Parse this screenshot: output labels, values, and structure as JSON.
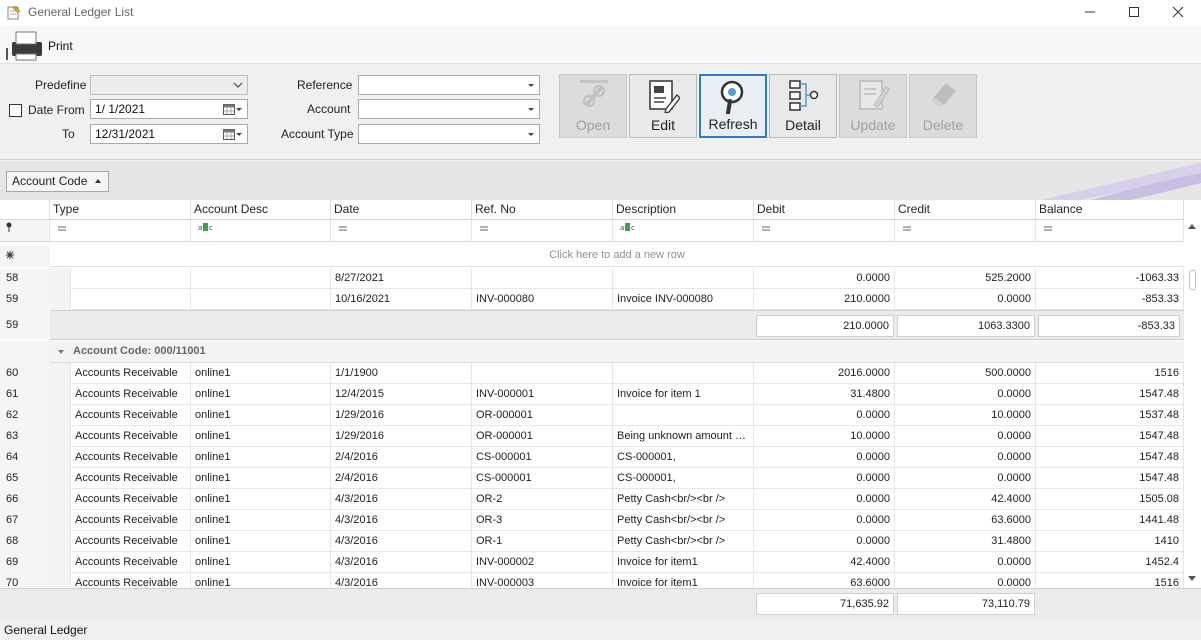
{
  "window": {
    "title": "General Ledger List",
    "minimize_icon": "minimize-icon",
    "maximize_icon": "maximize-icon",
    "close_icon": "close-icon"
  },
  "toolbar": {
    "print_label": "Print",
    "print_icon": "printer-icon"
  },
  "filters": {
    "predefine_label": "Predefine",
    "predefine_value": "",
    "date_from_label": "Date From",
    "date_from_checked": false,
    "date_from_value": "1/  1/2021",
    "to_label": "To",
    "to_value": "12/31/2021",
    "reference_label": "Reference",
    "reference_value": "",
    "account_label": "Account",
    "account_value": "",
    "account_type_label": "Account Type",
    "account_type_value": ""
  },
  "actions": {
    "open": {
      "label": "Open",
      "enabled": false,
      "icon": "link-icon"
    },
    "edit": {
      "label": "Edit",
      "enabled": true,
      "icon": "edit-document-icon"
    },
    "refresh": {
      "label": "Refresh",
      "enabled": true,
      "selected": true,
      "icon": "search-refresh-icon"
    },
    "detail": {
      "label": "Detail",
      "enabled": true,
      "icon": "hierarchy-icon"
    },
    "update": {
      "label": "Update",
      "enabled": false,
      "icon": "update-icon"
    },
    "delete": {
      "label": "Delete",
      "enabled": false,
      "icon": "eraser-icon"
    }
  },
  "group_panel": {
    "group_by": "Account Code",
    "sort": "ascending"
  },
  "grid": {
    "columns": [
      "Type",
      "Account Desc",
      "Date",
      "Ref. No",
      "Description",
      "Debit",
      "Credit",
      "Balance"
    ],
    "new_row_text": "Click here to add a new row",
    "top_rows": [
      {
        "n": "58",
        "type": "",
        "desc": "",
        "date": "8/27/2021",
        "ref": "",
        "description": "",
        "debit": "0.0000",
        "credit": "525.2000",
        "balance": "-1063.33"
      },
      {
        "n": "59",
        "type": "",
        "desc": "",
        "date": "10/16/2021",
        "ref": "INV-000080",
        "description": "Invoice INV-000080",
        "debit": "210.0000",
        "credit": "0.0000",
        "balance": "-853.33"
      }
    ],
    "subtotal": {
      "n": "59",
      "debit": "210.0000",
      "credit": "1063.3300",
      "balance": "-853.33"
    },
    "group_label": "Account Code: 000/11001",
    "rows": [
      {
        "n": "60",
        "type": "Accounts Receivable",
        "desc": "online1",
        "date": "1/1/1900",
        "ref": "",
        "description": "",
        "debit": "2016.0000",
        "credit": "500.0000",
        "balance": "1516"
      },
      {
        "n": "61",
        "type": "Accounts Receivable",
        "desc": "online1",
        "date": "12/4/2015",
        "ref": "INV-000001",
        "description": "Invoice for item 1",
        "debit": "31.4800",
        "credit": "0.0000",
        "balance": "1547.48"
      },
      {
        "n": "62",
        "type": "Accounts Receivable",
        "desc": "online1",
        "date": "1/29/2016",
        "ref": "OR-000001",
        "description": "",
        "debit": "0.0000",
        "credit": "10.0000",
        "balance": "1537.48"
      },
      {
        "n": "63",
        "type": "Accounts Receivable",
        "desc": "online1",
        "date": "1/29/2016",
        "ref": "OR-000001",
        "description": "Being unknown amount u...",
        "debit": "10.0000",
        "credit": "0.0000",
        "balance": "1547.48"
      },
      {
        "n": "64",
        "type": "Accounts Receivable",
        "desc": "online1",
        "date": "2/4/2016",
        "ref": "CS-000001",
        "description": "CS-000001,",
        "debit": "0.0000",
        "credit": "0.0000",
        "balance": "1547.48"
      },
      {
        "n": "65",
        "type": "Accounts Receivable",
        "desc": "online1",
        "date": "2/4/2016",
        "ref": "CS-000001",
        "description": "CS-000001,",
        "debit": "0.0000",
        "credit": "0.0000",
        "balance": "1547.48"
      },
      {
        "n": "66",
        "type": "Accounts Receivable",
        "desc": "online1",
        "date": "4/3/2016",
        "ref": "OR-2",
        "description": "Petty Cash<br/><br />",
        "debit": "0.0000",
        "credit": "42.4000",
        "balance": "1505.08"
      },
      {
        "n": "67",
        "type": "Accounts Receivable",
        "desc": "online1",
        "date": "4/3/2016",
        "ref": "OR-3",
        "description": "Petty Cash<br/><br />",
        "debit": "0.0000",
        "credit": "63.6000",
        "balance": "1441.48"
      },
      {
        "n": "68",
        "type": "Accounts Receivable",
        "desc": "online1",
        "date": "4/3/2016",
        "ref": "OR-1",
        "description": "Petty Cash<br/><br />",
        "debit": "0.0000",
        "credit": "31.4800",
        "balance": "1410"
      },
      {
        "n": "69",
        "type": "Accounts Receivable",
        "desc": "online1",
        "date": "4/3/2016",
        "ref": "INV-000002",
        "description": "Invoice for item1",
        "debit": "42.4000",
        "credit": "0.0000",
        "balance": "1452.4"
      },
      {
        "n": "70",
        "type": "Accounts Receivable",
        "desc": "online1",
        "date": "4/3/2016",
        "ref": "INV-000003",
        "description": "Invoice for item1",
        "debit": "63.6000",
        "credit": "0.0000",
        "balance": "1516"
      }
    ],
    "totals": {
      "debit": "71,635.92",
      "credit": "73,110.79"
    }
  },
  "status": {
    "text": "General Ledger"
  },
  "colors": {
    "selected_border": "#2c7cc5",
    "group_text": "#666666",
    "new_row_text": "#909090"
  }
}
